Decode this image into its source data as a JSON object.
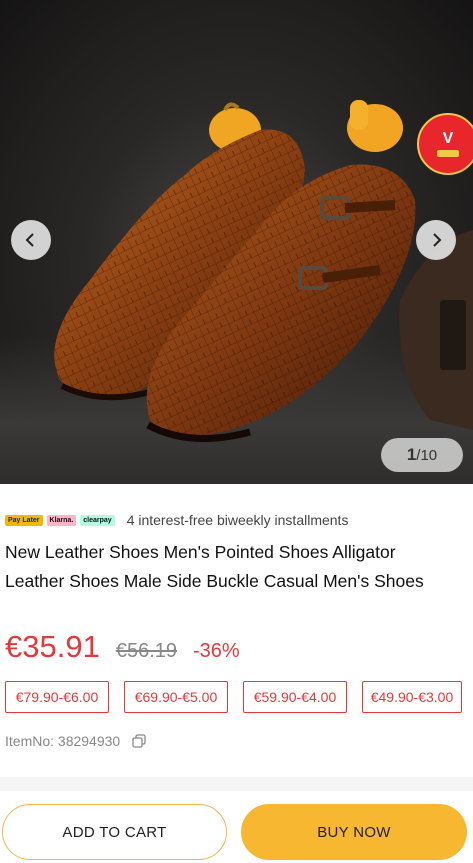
{
  "gallery": {
    "current": "1",
    "total": "/10",
    "product_image": "brown-crocodile-monk-strap-shoes-image"
  },
  "payment": {
    "logos": [
      "Pay Later",
      "Klarna.",
      "clearpay"
    ],
    "installment_text": "4 interest-free biweekly installments"
  },
  "product": {
    "title": "New Leather Shoes Men's Pointed Shoes Alligator Leather Shoes Male Side Buckle Casual Men's Shoes",
    "price": "€35.91",
    "original_price": "€56.19",
    "discount": "-36%",
    "price_tiers": [
      "€79.90-€6.00",
      "€69.90-€5.00",
      "€59.90-€4.00",
      "€49.90-€3.00"
    ],
    "item_no": "ItemNo: 38294930"
  },
  "actions": {
    "add_to_cart": "ADD TO CART",
    "buy_now": "BUY NOW"
  },
  "colors": {
    "price_red": "#e4393c",
    "buy_yellow": "#f7b731",
    "cart_border": "#f5b54a"
  }
}
